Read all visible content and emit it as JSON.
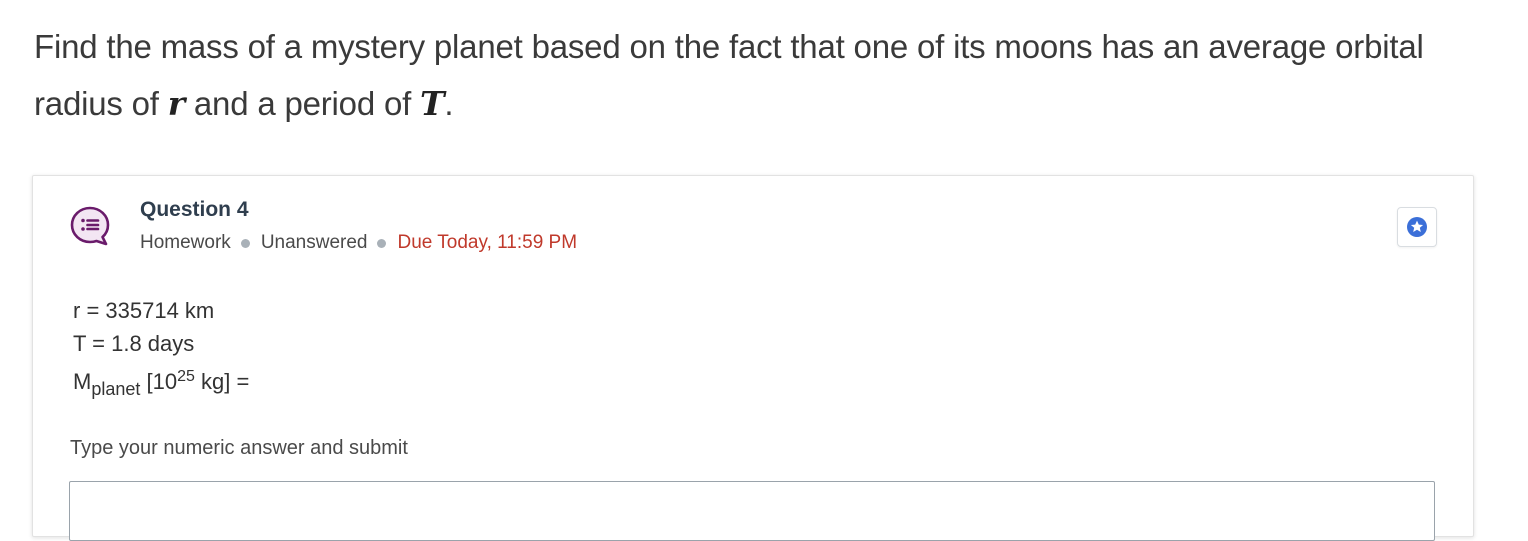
{
  "prompt": {
    "text_before_r": "Find the mass of a mystery planet based on the fact that one of its moons has an average orbital radius of ",
    "var_r": "r",
    "text_between": " and a period of ",
    "var_T": "T",
    "text_end": "."
  },
  "question": {
    "title": "Question 4",
    "type": "Homework",
    "status": "Unanswered",
    "due": "Due Today, 11:59 PM",
    "icon": "question-bubble-icon",
    "star_icon": "star-icon"
  },
  "params": {
    "r_line": "r = 335714 km",
    "T_line": "T = 1.8 days",
    "M_symbol": "M",
    "M_sub": "planet",
    "M_unit_open": " [10",
    "M_exp": "25",
    "M_unit_close": " kg] ="
  },
  "answer": {
    "label": "Type your numeric answer and submit",
    "value": "",
    "placeholder": ""
  },
  "colors": {
    "icon_purple": "#6a1b6b",
    "due_red": "#c0392b",
    "star_blue": "#3b6fd8"
  }
}
